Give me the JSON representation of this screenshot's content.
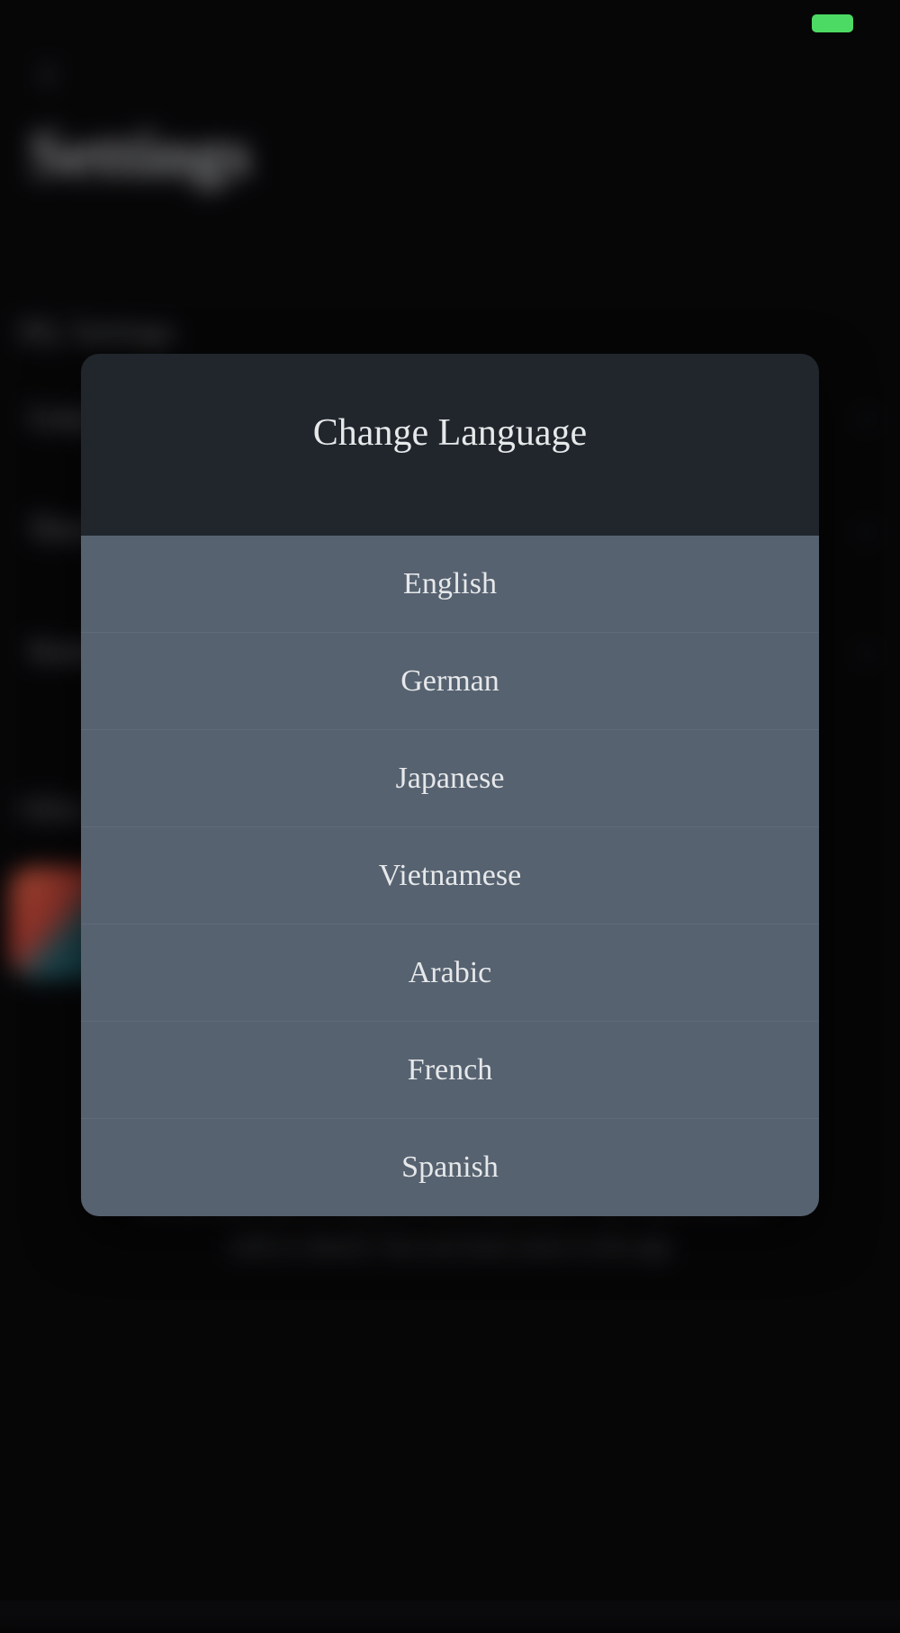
{
  "statusbar": {
    "battery_color": "#4cd964"
  },
  "header": {
    "back_glyph": "‹",
    "title": "Settings"
  },
  "background": {
    "section1": "My Settings",
    "row1": "Language",
    "row2": "Theme",
    "row3": "Sounds",
    "section2": "Other",
    "footer": "We use data only to improve your experience. Your data is never sold or shared. You can learn more in the app"
  },
  "modal": {
    "title": "Change Language",
    "options": [
      {
        "label": "English"
      },
      {
        "label": "German"
      },
      {
        "label": "Japanese"
      },
      {
        "label": "Vietnamese"
      },
      {
        "label": "Arabic"
      },
      {
        "label": "French"
      },
      {
        "label": "Spanish"
      }
    ]
  }
}
